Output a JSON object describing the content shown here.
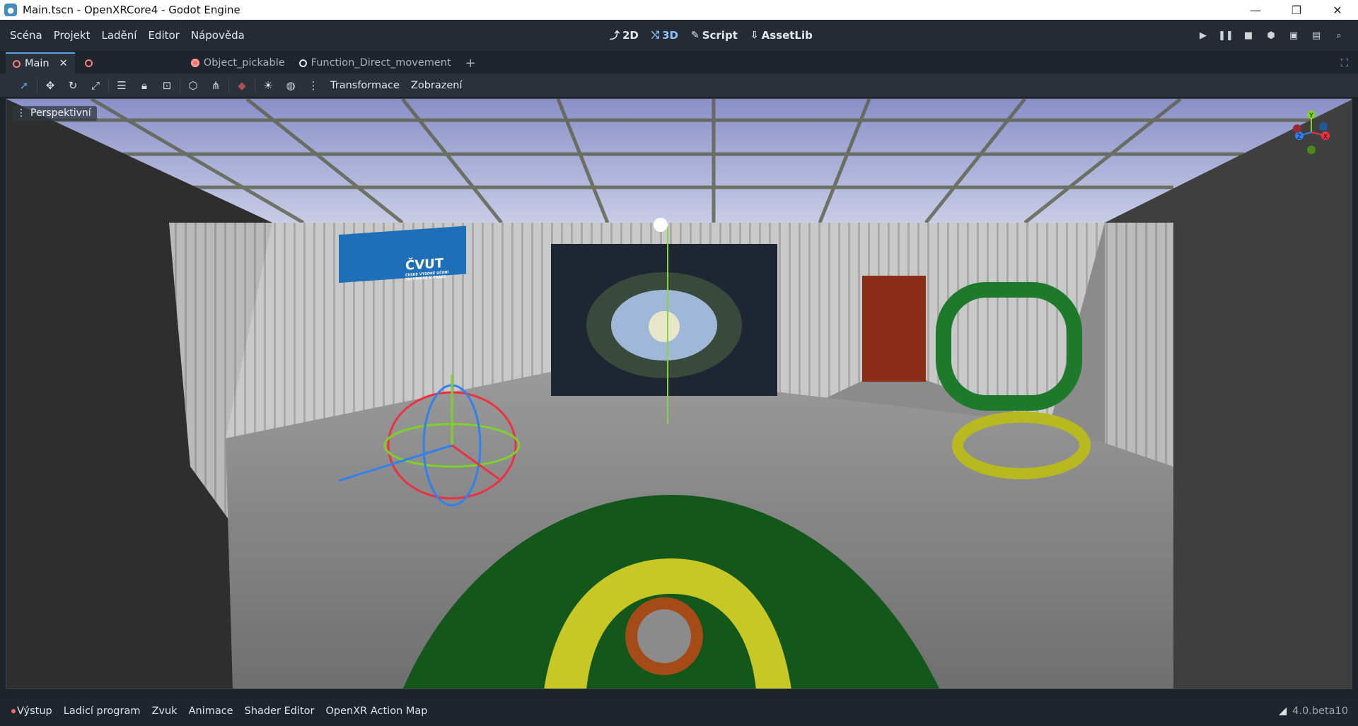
{
  "window": {
    "title": "Main.tscn - OpenXRCore4 - Godot Engine",
    "controls": [
      "minimize",
      "restore",
      "close"
    ]
  },
  "menus": [
    "Scéna",
    "Projekt",
    "Ladění",
    "Editor",
    "Nápověda"
  ],
  "workspaces": [
    {
      "label": "2D",
      "icon": "2d-icon"
    },
    {
      "label": "3D",
      "icon": "3d-icon"
    },
    {
      "label": "Script",
      "icon": "script-icon"
    },
    {
      "label": "AssetLib",
      "icon": "assetlib-icon"
    }
  ],
  "tabs": [
    {
      "label": "Main"
    },
    {
      "label": ""
    },
    {
      "label": "Object_pickable"
    },
    {
      "label": "Function_Direct_movement"
    }
  ],
  "toolbar": {
    "transform_label": "Transformace",
    "view_label": "Zobrazení"
  },
  "viewport": {
    "perspective_label": "Perspektivní",
    "logo_text": "ČVUT",
    "logo_sub": "ČESKÉ VYSOKÉ UČENÍ TECHNICKÉ V PRAZE",
    "gizmo": {
      "y": "Y",
      "x": "X",
      "z": "Z"
    }
  },
  "bottom": {
    "items": [
      "Výstup",
      "Ladicí program",
      "Zvuk",
      "Animace",
      "Shader Editor",
      "OpenXR Action Map"
    ],
    "version": "4.0.beta10"
  },
  "colors": {
    "accent": "#5fa2e6",
    "bg": "#1d2229"
  }
}
